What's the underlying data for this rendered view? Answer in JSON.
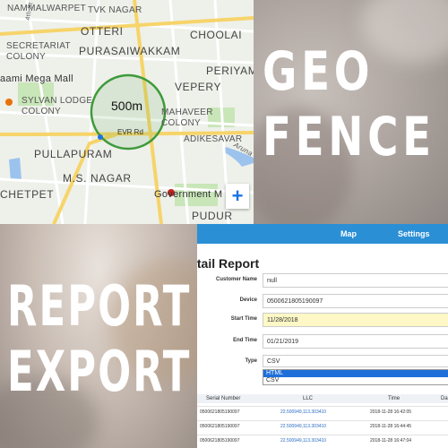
{
  "map": {
    "labels": {
      "nammalwarpet": "NAMMALWARPET",
      "tvk_nagar": "TVK NAGAR",
      "fourth_st": "4th St",
      "otteri": "OTTERI",
      "choolai": "CHOOLAI",
      "purasaiwakkam": "PURASAIWAKKAM",
      "secretariat_colony": "SECRETARIAT\nCOLONY",
      "periyam": "PERIYAM",
      "aami_mega_mall": "aami Mega Mall",
      "vepery": "VEPERY",
      "sylvan_lodge_colony": "SYLVAN LODGE\nCOLONY",
      "mahaveer_colony": "MAHAVEER\nCOLONY",
      "adikesavar": "ADIKESAVAR",
      "pullapuram": "PULLAPURAM",
      "aruna": "Aruna",
      "ms_nagar": "M.S. NAGAR",
      "chetpet": "CHETPET",
      "government_m": "Government M",
      "pudur": "PUDUR"
    },
    "geofence_radius_label": "500m",
    "road_label": "EVR Rd",
    "zoom_in_label": "+",
    "colors": {
      "fence": "#3d9a3a",
      "road": "#f6d46a",
      "park": "#c8e6b8",
      "water": "#9cc3ee"
    }
  },
  "geo_fence": {
    "line1": "GEO",
    "line2": "FENCE"
  },
  "report_export": {
    "line1": "REPORT",
    "line2": "EXPORT"
  },
  "app": {
    "nav": {
      "map": "Map",
      "settings": "Settings"
    },
    "title": "Detail Report",
    "fields": {
      "customer_name": {
        "label": "Customer Name",
        "value": "null"
      },
      "device": {
        "label": "Device",
        "value": "0500621805190097"
      },
      "start_time": {
        "label": "Start Time",
        "value": "11/28/2018"
      },
      "end_time": {
        "label": "End Time",
        "value": "01/21/2019"
      },
      "type": {
        "label": "Type",
        "value": "CSV"
      }
    },
    "type_options": [
      "HTML",
      "CSV"
    ],
    "type_selected": "HTML",
    "table": {
      "headers": [
        "Serial Number",
        "LLC",
        "Time",
        "Da"
      ],
      "rows": [
        [
          "0500621805190097",
          "22.500949,113.303410",
          "2018-11-28 16:42:05"
        ],
        [
          "0500621805190097",
          "22.500949,113.303410",
          "2018-11-28 16:44:45"
        ],
        [
          "0500621805190097",
          "22.500949,113.303410",
          "2018-11-28 16:47:04"
        ]
      ]
    },
    "colors": {
      "topbar": "#2b8fd6",
      "link": "#2b6cc4",
      "highlight": "#fdf8c6",
      "select": "#1e6fd9"
    }
  }
}
